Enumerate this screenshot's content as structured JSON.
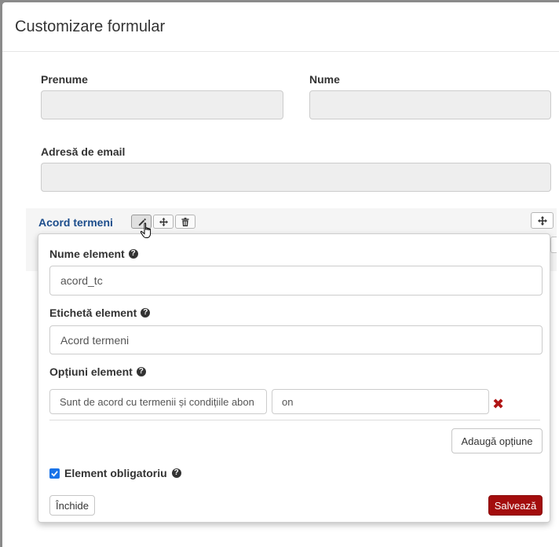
{
  "modal": {
    "title": "Customizare formular"
  },
  "form": {
    "first_name_label": "Prenume",
    "last_name_label": "Nume",
    "email_label": "Adresă de email"
  },
  "element": {
    "title": "Acord termeni",
    "tools": [
      "pencil-icon",
      "move-icon",
      "trash-icon"
    ]
  },
  "editor": {
    "name_label": "Nume element",
    "name_value": "acord_tc",
    "caption_label": "Etichetă element",
    "caption_value": "Acord termeni",
    "options_label": "Opțiuni element",
    "options": [
      {
        "label": "Sunt de acord cu termenii și condițiile abon",
        "value": "on"
      }
    ],
    "add_option_label": "Adaugă opțiune",
    "required_label": "Element obligatoriu",
    "required_checked": true,
    "close_label": "Închide",
    "save_label": "Salvează"
  },
  "colors": {
    "accent": "#1c4d8c",
    "save": "#a30d0d",
    "remove": "#b01515",
    "checkbox": "#1a73e8"
  }
}
